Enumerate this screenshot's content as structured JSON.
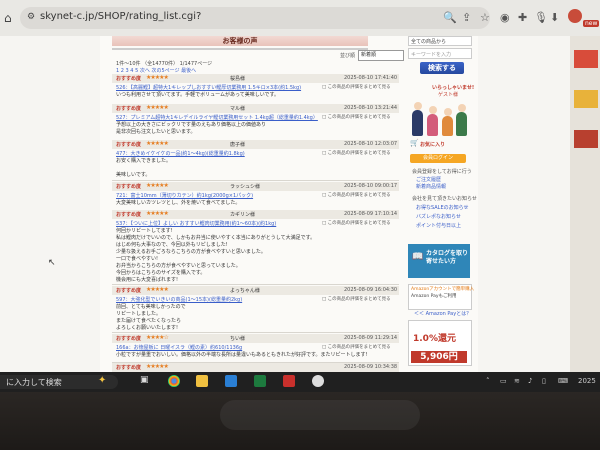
{
  "browser": {
    "url": "skynet-c.jp/SHOP/rating_list.cgi?",
    "icons": [
      "home-icon",
      "site-info-icon",
      "zoom-icon",
      "share-icon",
      "star-icon",
      "profile-icon",
      "mic-icon",
      "download-icon"
    ]
  },
  "page": {
    "title": "お客様の声",
    "sort_label": "並び順",
    "sort_value": "新着順",
    "meta_line1": "1件～10件 （全14770件）  1/1477ページ",
    "meta_line2": "1 2 3 4 5 次へ  次の5ページ  最後へ"
  },
  "reviews": [
    {
      "label": "おすすめ度",
      "stars": "★★★★★",
      "name": "桜島様",
      "date": "2025-08-10 17:41:40",
      "product": "526：【高麗鰹】超特大1キレップしおすすい鰹厚切業務用 1.5キロ×3本(約1.5kg)",
      "help": "□ この商品の評価をまとめて見る",
      "body": [
        "いつも利用させて頂いてます。手軽でボリュームがあって美味しいです。"
      ]
    },
    {
      "label": "おすすめ度",
      "stars": "★★★★★",
      "name": "マル様",
      "date": "2025-08-10 13:21:44",
      "product": "527：プレミアム超特大1キレデイルライヤ鰹切業務用セット 1.4kg超（総重量約1.4kg）",
      "help": "□ この商品の評価をまとめて見る",
      "body": [
        "予想以上の大きさにビックリです量のえもあり価格以上の価値あり",
        "是非次回も注文したいと思います。"
      ]
    },
    {
      "label": "おすすめ度",
      "stars": "★★★★★",
      "name": "唐子様",
      "date": "2025-08-10 12:03:07",
      "product": "477：大きめイケイケの一品(約1～4kg)(総重量約1.8kg)",
      "help": "□ この商品の評価をまとめて見る",
      "body": [
        "お安く購入できました。",
        "",
        "美味しいです。"
      ]
    },
    {
      "label": "おすすめ度",
      "stars": "★★★★★",
      "name": "ラッシュシ様",
      "date": "2025-08-10 09:00:17",
      "product": "721：富士10mm（薄切りカテン）約1kg(2000g×1パック)",
      "help": "□ この商品の評価をまとめて見る",
      "body": [
        "大変美味しいカツレツとし、外を焼いて食べてました。"
      ]
    },
    {
      "label": "おすすめ度",
      "stars": "★★★★★",
      "name": "カギリン様",
      "date": "2025-08-09 17:10:14",
      "product": "537：【ついに上位】よしい おすすい鰹肉切業務用(約1～60本)(約1kg)",
      "help": "□ この商品の評価をまとめて見る",
      "body": [
        "何回かリピートしてます!",
        "私は鰹肉だけでいいので、しかもお弁当に使いやすく本当にありがとうして大満足です。",
        "はじめ何も大事なので、今回以外もリピしました!",
        "少量な扱えるお手ごろならこちらの方が食べやすいと思いました。",
        "一口で食べやすい!",
        "お弁当からこちらの方が食べやすいと思っていました。",
        "今回からはこちらのサイズを購入です。",
        "機会用にも大変喜ばれます!"
      ]
    },
    {
      "label": "おすすめ度",
      "stars": "★★★★★",
      "name": "よっちゃん様",
      "date": "2025-08-09 16:04:30",
      "product": "597：大強化型でいきいの商品(1～15本)(総重量約2kg)",
      "help": "□ この商品の評価をまとめて見る",
      "body": [
        "前回、とても美味しかったので",
        "リピートしました。",
        "また届けて食べたくなったら",
        "よろしくお願いいたします!"
      ]
    },
    {
      "label": "おすすめ度",
      "stars": "★★★★☆",
      "name": "ちい様",
      "date": "2025-08-09 11:29:14",
      "product": "166a：お徳屋板に 日曜イスラ（鰹の素）約610/1136g",
      "help": "□ この商品の評価をまとめて見る",
      "body": [
        "小粒ですが量重でおいしい。価格以外の半端な長所は量違いもあるともきれたが好評です。またリピートします!"
      ]
    },
    {
      "label": "おすすめ度",
      "stars": "★★★★★",
      "name": "",
      "date": "2025-08-09 10:34:38",
      "product": "",
      "help": "",
      "body": []
    }
  ],
  "sidebar": {
    "search_select": "全ての商品から",
    "search_placeholder": "キーワードを入力",
    "search_button": "検索する",
    "welcome": "いらっしゃいませ!",
    "welcome_sub": "ゲスト様",
    "cart": "お気に入り",
    "login": "会員ログイン",
    "links": [
      "会員登録をしてお得に行う",
      "ご注文履歴",
      "新着商品情報"
    ],
    "info_title": "会社を見て頂きたいお知らせ",
    "info_links": [
      "お得なSALEのお知らせ",
      "バズレポなお知らせ",
      "ポイント付与日以上"
    ],
    "catalog": "カタログを取り寄せたい方",
    "amazon1_title": "Amazonアカウントで簡単購入",
    "amazon1_body": "Amazon Payもご利用",
    "amazon1_link": "＜＜ Amazon Payとは？",
    "amazon2_badge": "1.0%還元",
    "amazon2_price": "5,906円"
  },
  "taskbar": {
    "search_text": "に入力して検索",
    "time": "2025"
  }
}
